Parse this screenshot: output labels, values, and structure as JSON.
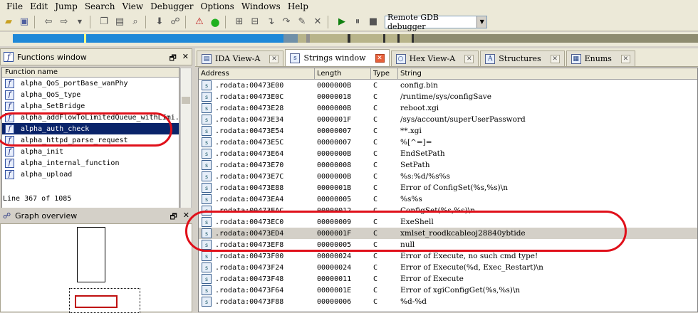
{
  "menu": [
    "File",
    "Edit",
    "Jump",
    "Search",
    "View",
    "Debugger",
    "Options",
    "Windows",
    "Help"
  ],
  "toolbar": {
    "debugger_select": "Remote GDB debugger"
  },
  "functions_window": {
    "title": "Functions window",
    "column": "Function name",
    "items": [
      "alpha_QoS_portBase_wanPhy",
      "alpha_QoS_type",
      "alpha_SetBridge",
      "alpha_addFlowToLimitedQueue_withLImi...",
      "alpha_auth_check",
      "alpha_httpd_parse_request",
      "alpha_init",
      "alpha_internal_function",
      "alpha_upload"
    ],
    "selected_index": 4,
    "line_info": "Line 367 of 1085"
  },
  "graph_overview": {
    "title": "Graph overview"
  },
  "tabs": [
    {
      "label": "IDA View-A",
      "active": false
    },
    {
      "label": "Strings window",
      "active": true
    },
    {
      "label": "Hex View-A",
      "active": false
    },
    {
      "label": "Structures",
      "active": false
    },
    {
      "label": "Enums",
      "active": false
    }
  ],
  "strings_window": {
    "columns": [
      "Address",
      "Length",
      "Type",
      "String"
    ],
    "rows": [
      {
        "address": ".rodata:00473E00",
        "length": "0000000B",
        "type": "C",
        "string": "config.bin"
      },
      {
        "address": ".rodata:00473E0C",
        "length": "00000018",
        "type": "C",
        "string": "/runtime/sys/configSave"
      },
      {
        "address": ".rodata:00473E28",
        "length": "0000000B",
        "type": "C",
        "string": "reboot.xgi"
      },
      {
        "address": ".rodata:00473E34",
        "length": "0000001F",
        "type": "C",
        "string": "/sys/account/superUserPassword"
      },
      {
        "address": ".rodata:00473E54",
        "length": "00000007",
        "type": "C",
        "string": "**.xgi"
      },
      {
        "address": ".rodata:00473E5C",
        "length": "00000007",
        "type": "C",
        "string": "%[^=]="
      },
      {
        "address": ".rodata:00473E64",
        "length": "0000000B",
        "type": "C",
        "string": "EndSetPath"
      },
      {
        "address": ".rodata:00473E70",
        "length": "00000008",
        "type": "C",
        "string": "SetPath"
      },
      {
        "address": ".rodata:00473E7C",
        "length": "0000000B",
        "type": "C",
        "string": "%s:%d/%s%s"
      },
      {
        "address": ".rodata:00473E88",
        "length": "0000001B",
        "type": "C",
        "string": "Error of ConfigSet(%s,%s)\\n"
      },
      {
        "address": ".rodata:00473EA4",
        "length": "00000005",
        "type": "C",
        "string": "%s%s"
      },
      {
        "address": ".rodata:00473EAC",
        "length": "00000012",
        "type": "C",
        "string": "ConfigSet(%s,%s)\\n"
      },
      {
        "address": ".rodata:00473EC0",
        "length": "00000009",
        "type": "C",
        "string": "ExeShell"
      },
      {
        "address": ".rodata:00473ED4",
        "length": "0000001F",
        "type": "C",
        "string": "xmlset_roodkcableoj28840ybtide"
      },
      {
        "address": ".rodata:00473EF8",
        "length": "00000005",
        "type": "C",
        "string": "null"
      },
      {
        "address": ".rodata:00473F00",
        "length": "00000024",
        "type": "C",
        "string": "Error of Execute, no such cmd type!"
      },
      {
        "address": ".rodata:00473F24",
        "length": "00000024",
        "type": "C",
        "string": "Error of Execute(%d, Exec_Restart)\\n"
      },
      {
        "address": ".rodata:00473F48",
        "length": "00000011",
        "type": "C",
        "string": "Error of Execute"
      },
      {
        "address": ".rodata:00473F64",
        "length": "0000001E",
        "type": "C",
        "string": "Error of xgiConfigGet(%s,%s)\\n"
      },
      {
        "address": ".rodata:00473F88",
        "length": "00000006",
        "type": "C",
        "string": "%d-%d"
      }
    ],
    "highlighted_index": 13
  },
  "colors": {
    "selection": "#0a246a",
    "annotation": "#e0101a",
    "nav_blue": "#1e88d8"
  }
}
